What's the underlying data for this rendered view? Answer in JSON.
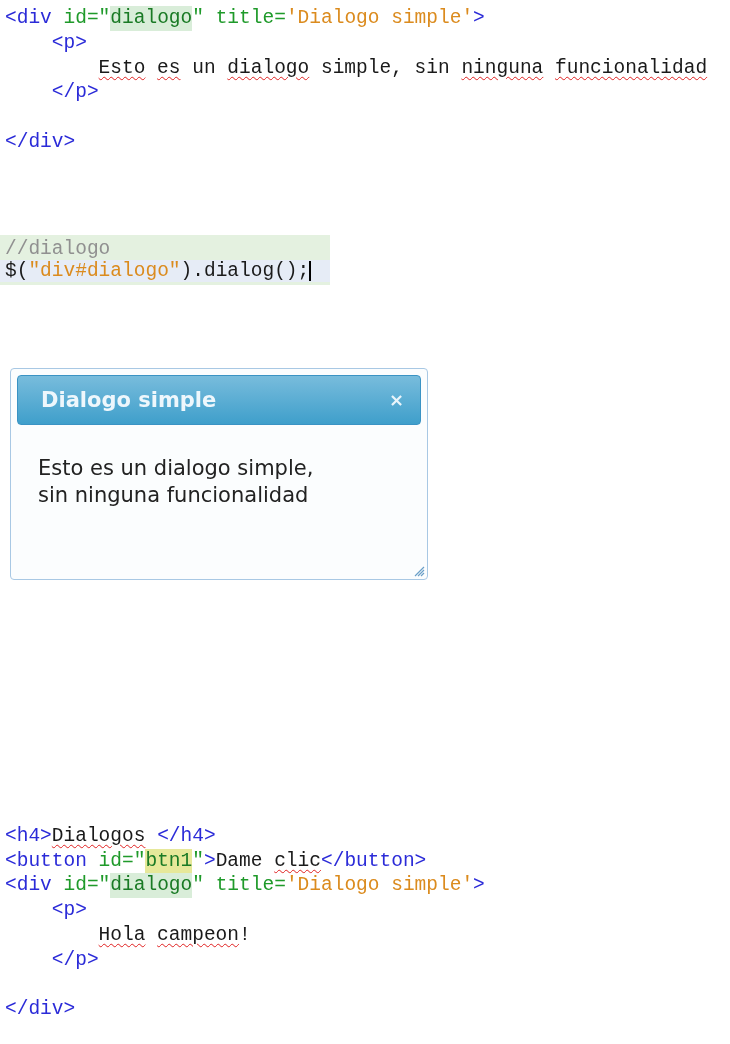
{
  "blocks": [
    {
      "kind": "plain",
      "lines": [
        {
          "tokens": [
            {
              "kind": "tag",
              "text": "<div"
            },
            {
              "kind": "attr",
              "text": " id=\""
            },
            {
              "kind": "match",
              "text": "dialogo"
            },
            {
              "kind": "attr",
              "text": "\" title="
            },
            {
              "kind": "string",
              "text": "'Dialogo simple'"
            },
            {
              "kind": "tag",
              "text": ">"
            }
          ],
          "children": [
            {
              "tokens": [
                {
                  "kind": "tag",
                  "text": "<p>"
                }
              ],
              "children": [
                {
                  "tokens": [
                    {
                      "kind": "typo",
                      "text": "Esto"
                    },
                    {
                      "kind": "typo",
                      "text": "es",
                      "space": true
                    },
                    {
                      "kind": "text",
                      "text": " un "
                    },
                    {
                      "kind": "typo",
                      "text": "dialogo"
                    },
                    {
                      "kind": "text",
                      "text": " simple, sin "
                    },
                    {
                      "kind": "typo",
                      "text": "ninguna"
                    },
                    {
                      "kind": "typo",
                      "text": "funcionalidad",
                      "space": true
                    }
                  ]
                }
              ]
            },
            {
              "tokens": [
                {
                  "kind": "tag",
                  "text": "</p>"
                }
              ]
            }
          ]
        },
        {
          "tokens": [
            {
              "kind": "tag",
              "text": "</div>"
            }
          ]
        }
      ]
    },
    {
      "kind": "highlighted",
      "lines": [
        {
          "current": false,
          "tokens": [
            {
              "kind": "comment",
              "text": "//dialogo"
            }
          ]
        },
        {
          "current": true,
          "tokens": [
            {
              "kind": "code",
              "text": "$("
            },
            {
              "kind": "string",
              "text": "\"div#dialogo\""
            },
            {
              "kind": "code",
              "text": ").dialog();"
            }
          ]
        }
      ]
    },
    {
      "kind": "dialog",
      "title": "Dialogo simple",
      "close": "×",
      "body": "Esto es un dialogo simple, sin ninguna funcionalidad"
    },
    {
      "kind": "plain",
      "lines": [
        {
          "tokens": [
            {
              "kind": "tag",
              "text": "<h4>"
            },
            {
              "kind": "typo",
              "text": "Dialogos"
            },
            {
              "kind": "tag",
              "text": " </h4>"
            }
          ]
        },
        {
          "tokens": [
            {
              "kind": "tag",
              "text": "<button"
            },
            {
              "kind": "attr",
              "text": " id=\""
            },
            {
              "kind": "focus",
              "text": "btn1"
            },
            {
              "kind": "attr",
              "text": "\""
            },
            {
              "kind": "tag",
              "text": ">"
            },
            {
              "kind": "text",
              "text": "Dame "
            },
            {
              "kind": "typo",
              "text": "clic"
            },
            {
              "kind": "tag",
              "text": "</button>"
            }
          ]
        },
        {
          "tokens": [
            {
              "kind": "tag",
              "text": "<div"
            },
            {
              "kind": "attr",
              "text": " id=\""
            },
            {
              "kind": "match",
              "text": "dialogo"
            },
            {
              "kind": "attr",
              "text": "\" title="
            },
            {
              "kind": "string",
              "text": "'Dialogo simple'"
            },
            {
              "kind": "tag",
              "text": ">"
            }
          ],
          "children": [
            {
              "tokens": [
                {
                  "kind": "tag",
                  "text": "<p>"
                }
              ],
              "children": [
                {
                  "tokens": [
                    {
                      "kind": "typo",
                      "text": "Hola"
                    },
                    {
                      "kind": "typo",
                      "text": "campeon",
                      "space": true
                    },
                    {
                      "kind": "text",
                      "text": "!"
                    }
                  ]
                }
              ]
            },
            {
              "tokens": [
                {
                  "kind": "tag",
                  "text": "</p>"
                }
              ]
            }
          ]
        },
        {
          "tokens": [
            {
              "kind": "tag",
              "text": "</div>"
            }
          ]
        }
      ]
    }
  ]
}
